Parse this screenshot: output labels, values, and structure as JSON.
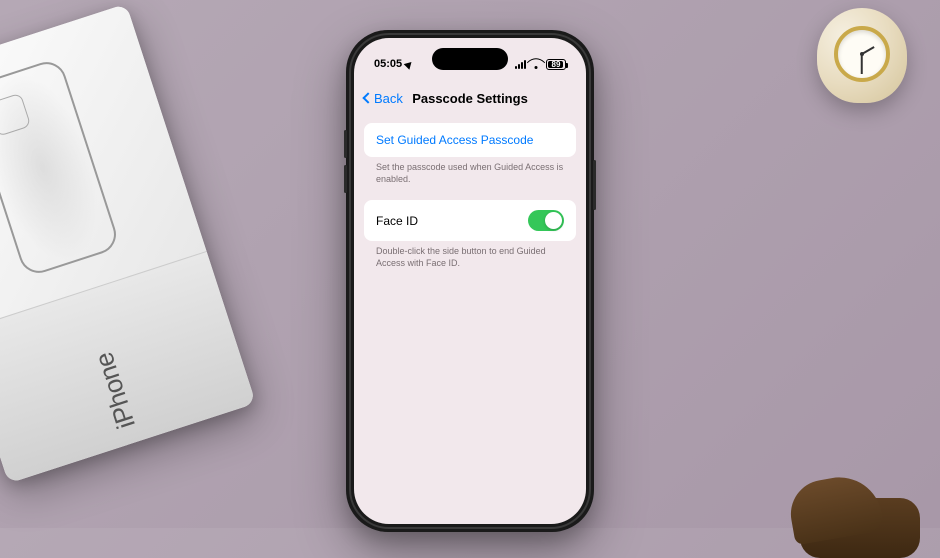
{
  "status_bar": {
    "time": "05:05",
    "battery": "89"
  },
  "nav": {
    "back_label": "Back",
    "title": "Passcode Settings"
  },
  "rows": {
    "set_passcode_label": "Set Guided Access Passcode",
    "set_passcode_footer": "Set the passcode used when Guided Access is enabled.",
    "face_id_label": "Face ID",
    "face_id_on": true,
    "face_id_footer": "Double-click the side button to end Guided Access with Face ID."
  },
  "props": {
    "box_brand": "iPhone"
  }
}
